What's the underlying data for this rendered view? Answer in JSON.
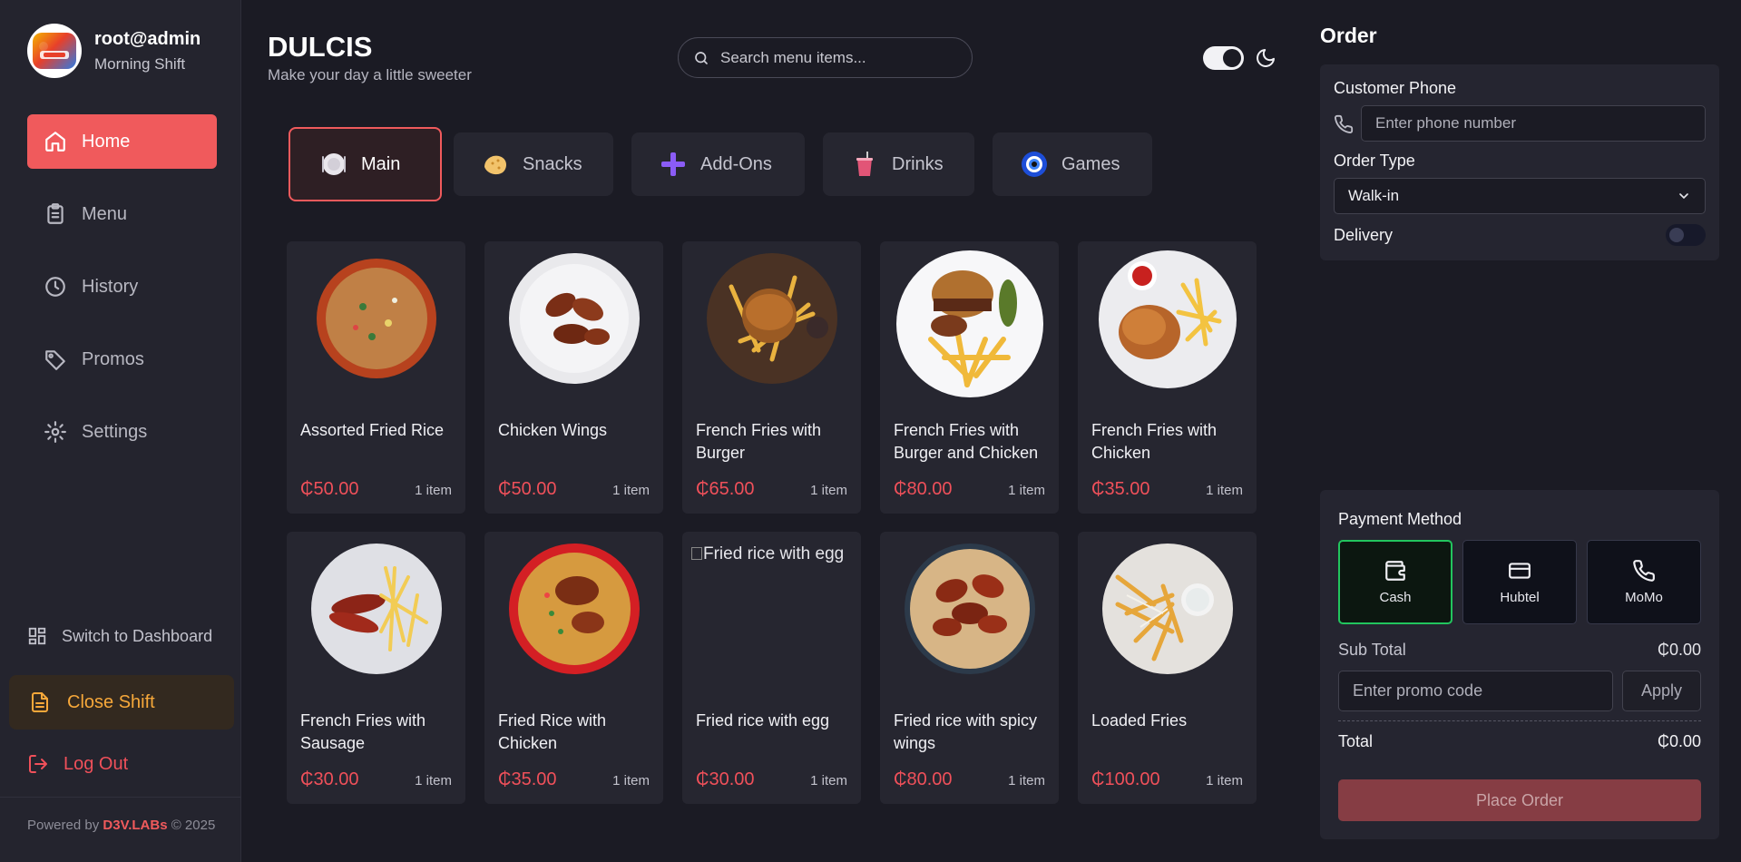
{
  "profile": {
    "name": "root@admin",
    "shift": "Morning Shift",
    "logo_text": "DULCIS"
  },
  "nav": {
    "items": [
      {
        "label": "Home",
        "icon": "home-icon",
        "active": true
      },
      {
        "label": "Menu",
        "icon": "clipboard-icon",
        "active": false
      },
      {
        "label": "History",
        "icon": "clock-icon",
        "active": false
      },
      {
        "label": "Promos",
        "icon": "tag-icon",
        "active": false
      },
      {
        "label": "Settings",
        "icon": "gear-icon",
        "active": false
      }
    ],
    "switch_dashboard": "Switch to Dashboard",
    "close_shift": "Close Shift",
    "logout": "Log Out",
    "powered_prefix": "Powered by",
    "powered_brand": "D3V.LABs",
    "powered_suffix": "© 2025"
  },
  "header": {
    "title": "DULCIS",
    "subtitle": "Make your day a little sweeter",
    "search_placeholder": "Search menu items..."
  },
  "categories": [
    {
      "label": "Main",
      "icon": "plate-icon",
      "active": true
    },
    {
      "label": "Snacks",
      "icon": "cookie-icon",
      "active": false
    },
    {
      "label": "Add-Ons",
      "icon": "plus-icon",
      "active": false
    },
    {
      "label": "Drinks",
      "icon": "cup-icon",
      "active": false
    },
    {
      "label": "Games",
      "icon": "nazar-icon",
      "active": false
    }
  ],
  "products": [
    {
      "name": "Assorted Fried Rice",
      "price": "₵50.00",
      "qty": "1 item",
      "image": "fried-rice-image"
    },
    {
      "name": "Chicken Wings",
      "price": "₵50.00",
      "qty": "1 item",
      "image": "chicken-wings-image"
    },
    {
      "name": "French Fries with Burger",
      "price": "₵65.00",
      "qty": "1 item",
      "image": "fries-burger-image"
    },
    {
      "name": "French Fries with Burger and Chicken",
      "price": "₵80.00",
      "qty": "1 item",
      "image": "fries-burger-chicken-image"
    },
    {
      "name": "French Fries with Chicken",
      "price": "₵35.00",
      "qty": "1 item",
      "image": "fries-chicken-image"
    },
    {
      "name": "French Fries with Sausage",
      "price": "₵30.00",
      "qty": "1 item",
      "image": "fries-sausage-image"
    },
    {
      "name": "Fried Rice with Chicken",
      "price": "₵35.00",
      "qty": "1 item",
      "image": "rice-chicken-image"
    },
    {
      "name": "Fried rice with egg",
      "price": "₵30.00",
      "qty": "1 item",
      "image": "broken-image",
      "alt": "Fried rice with egg"
    },
    {
      "name": "Fried rice with spicy wings",
      "price": "₵80.00",
      "qty": "1 item",
      "image": "rice-spicy-wings-image"
    },
    {
      "name": "Loaded Fries",
      "price": "₵100.00",
      "qty": "1 item",
      "image": "loaded-fries-image"
    }
  ],
  "order": {
    "title": "Order",
    "phone_label": "Customer Phone",
    "phone_placeholder": "Enter phone number",
    "type_label": "Order Type",
    "type_value": "Walk-in",
    "delivery_label": "Delivery",
    "payment_title": "Payment Method",
    "payment_methods": [
      {
        "label": "Cash",
        "icon": "wallet-icon",
        "active": true
      },
      {
        "label": "Hubtel",
        "icon": "card-icon",
        "active": false
      },
      {
        "label": "MoMo",
        "icon": "phone-icon",
        "active": false
      }
    ],
    "subtotal_label": "Sub Total",
    "subtotal_value": "₵0.00",
    "promo_placeholder": "Enter promo code",
    "apply_label": "Apply",
    "total_label": "Total",
    "total_value": "₵0.00",
    "place_order_label": "Place Order"
  },
  "colors": {
    "accent": "#f05a5c",
    "background": "#1b1b24",
    "panel": "#252530",
    "success": "#22c55e",
    "warning": "#f7a83a"
  }
}
